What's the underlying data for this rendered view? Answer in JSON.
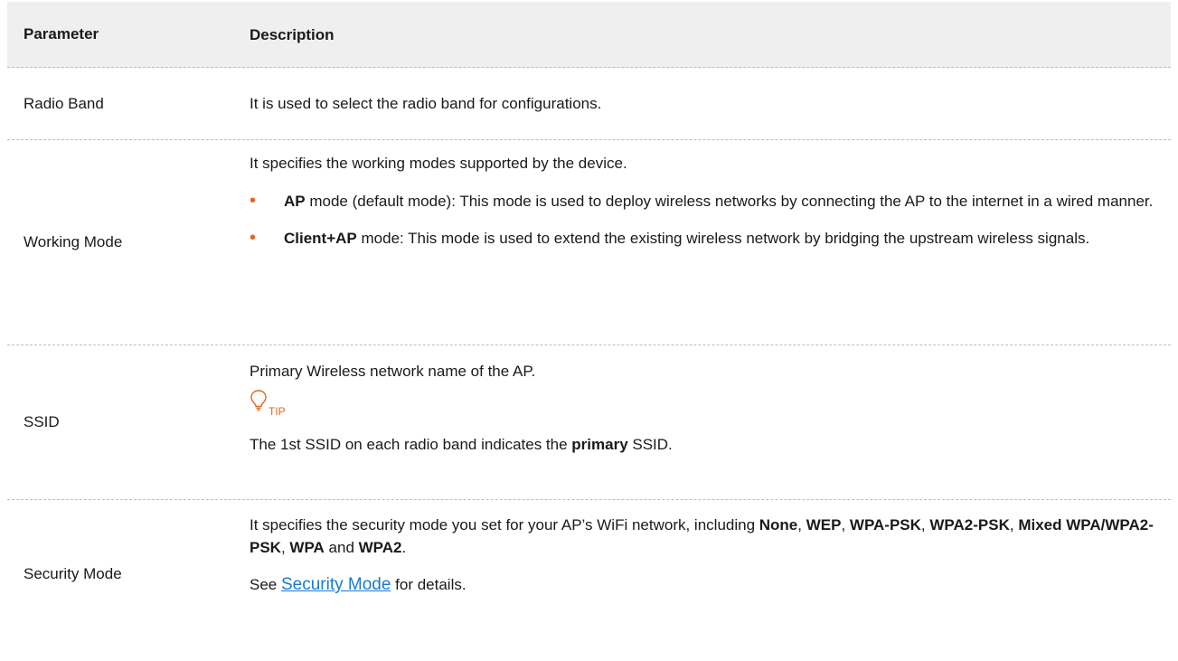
{
  "header": {
    "param": "Parameter",
    "desc": "Description"
  },
  "rows": {
    "radio_band": {
      "param": "Radio Band",
      "desc": "It is used to select the radio band for configurations."
    },
    "working_mode": {
      "param": "Working Mode",
      "intro": "It specifies the working modes supported by the device.",
      "bullet1_bold": "AP",
      "bullet1_text": " mode (default mode): This mode is used to deploy wireless networks by connecting the AP to the internet in a wired manner.",
      "bullet2_bold": "Client+AP",
      "bullet2_text": " mode: This mode is used to extend the existing wireless network by bridging the upstream wireless signals."
    },
    "ssid": {
      "param": "SSID",
      "intro": "Primary Wireless network name of the AP.",
      "tip_label": "TIP",
      "note_pre": "The 1st SSID on each radio band indicates the ",
      "note_bold": "primary",
      "note_post": " SSID."
    },
    "security_mode": {
      "param": "Security Mode",
      "t1": "It specifies the security mode you set for your AP’s WiFi network, including ",
      "m1": "None",
      "s1": ", ",
      "m2": "WEP",
      "s2": ", ",
      "m3": "WPA-PSK",
      "s3": ", ",
      "m4": "WPA2-PSK",
      "s4": ", ",
      "m5": "Mixed WPA/WPA2-PSK",
      "s5": ", ",
      "m6": "WPA",
      "s6": " and ",
      "m7": "WPA2",
      "s7": ".",
      "see_pre": "See ",
      "link": "Security Mode",
      "see_post": " for details."
    }
  },
  "colors": {
    "bullet": "#e8641c",
    "tip": "#e8641c",
    "link": "#1a7ad4",
    "header_bg": "#efefef"
  },
  "icons": {
    "tip": "lightbulb-icon",
    "bullet": "bullet-dot"
  }
}
